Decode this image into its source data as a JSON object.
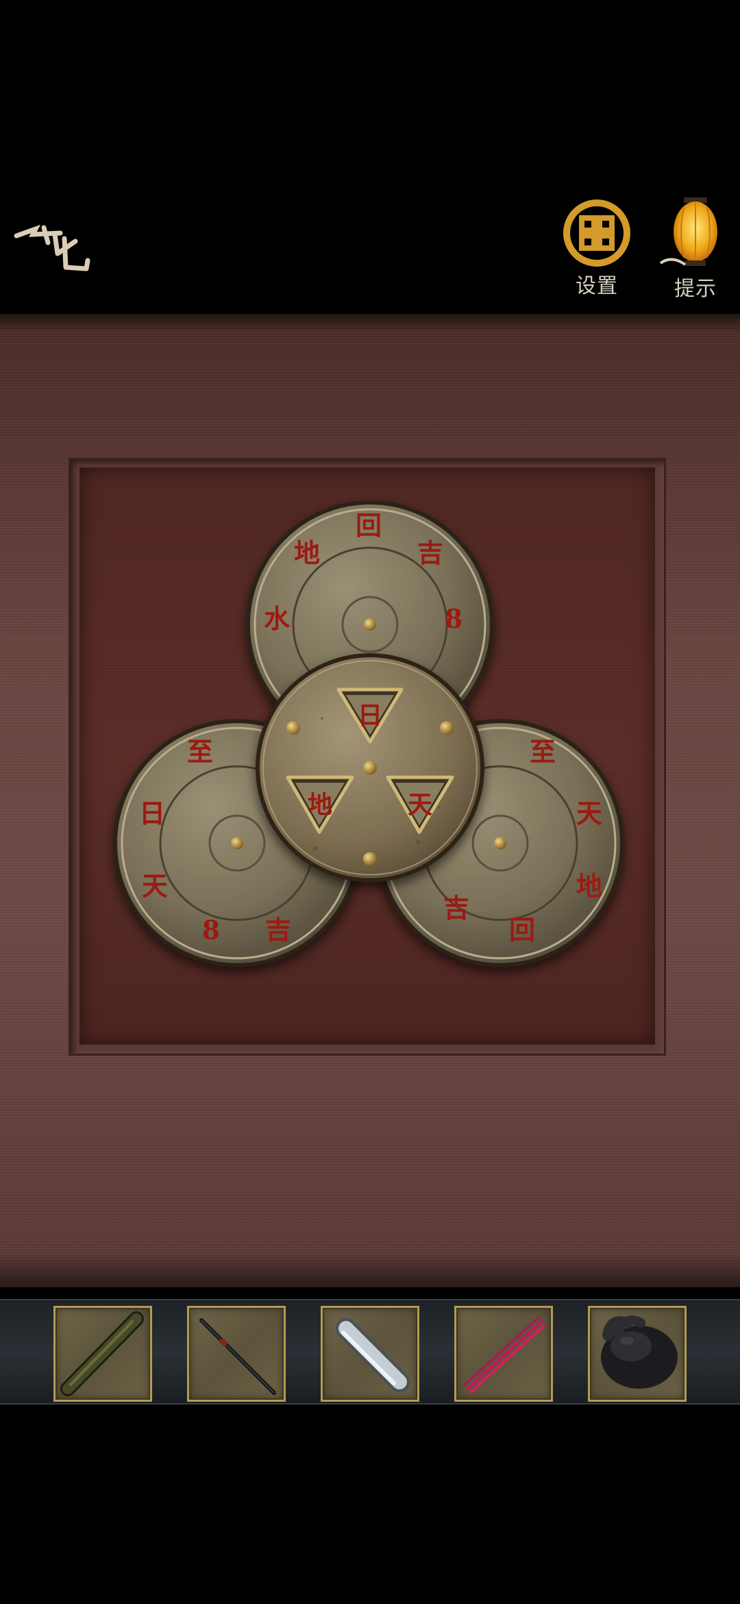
{
  "header": {
    "back_icon": "back-arrow-glyph-icon",
    "settings": {
      "label": "设置",
      "icon": "endless-knot-icon"
    },
    "hint": {
      "label": "提示",
      "icon": "lantern-icon"
    }
  },
  "puzzle": {
    "top_disc_glyphs": [
      "回",
      "吉",
      "8",
      "地",
      "水"
    ],
    "left_disc_glyphs": [
      "天",
      "日",
      "至",
      "8",
      "吉"
    ],
    "right_disc_glyphs": [
      "天",
      "至",
      "地",
      "回",
      "吉"
    ],
    "window_glyphs": [
      "日",
      "地",
      "天"
    ]
  },
  "inventory": [
    {
      "name": "bamboo-tube",
      "icon": "bamboo-tube-icon"
    },
    {
      "name": "iron-rod",
      "icon": "rod-icon"
    },
    {
      "name": "metal-cylinder",
      "icon": "cylinder-icon"
    },
    {
      "name": "incense-sticks",
      "icon": "incense-icon"
    },
    {
      "name": "black-stone-rabbit",
      "icon": "rabbit-stone-icon"
    }
  ],
  "colors": {
    "glyph_red": "#9c1a12",
    "gold": "#c8962e",
    "brass": "#a89a78"
  }
}
